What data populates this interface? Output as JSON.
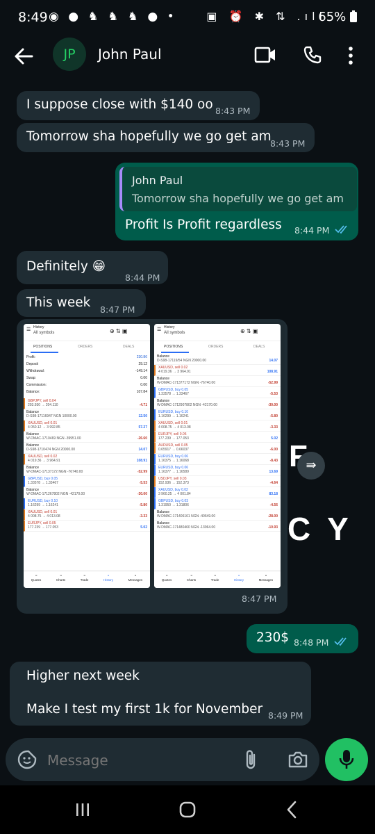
{
  "status_bar": {
    "time": "8:49",
    "left_icons": "◉ ● ♞ ♞ ♞ ● •",
    "right_icons": "▣ ⏰ ✱ ⇅ .ıll",
    "battery": "65%"
  },
  "header": {
    "avatar_initials": "JP",
    "contact_name": "John Paul"
  },
  "messages": [
    {
      "text": "I suppose close with $140 oo",
      "time": "8:43 PM"
    },
    {
      "text": "Tomorrow sha hopefully we go get am",
      "time": "8:43 PM"
    },
    {
      "quote_author": "John Paul",
      "quote_text": "Tomorrow sha hopefully we go get am",
      "text": "Profit Is Profit regardless",
      "time": "8:44 PM"
    },
    {
      "text": "Definitely 😁",
      "time": "8:44 PM"
    },
    {
      "text": "This week",
      "time": "8:47 PM"
    },
    {
      "time": "8:47 PM"
    },
    {
      "text": "230$",
      "time": "8:48 PM"
    },
    {
      "text": "Higher next week",
      "text2": "Make I test my first 1k for November",
      "time": "8:49 PM"
    }
  ],
  "overlay_letters": {
    "f": "F",
    "cy": "C Y"
  },
  "screenshot": {
    "title": "History",
    "subtitle": "All symbols",
    "tabs": [
      "POSITIONS",
      "ORDERS",
      "DEALS"
    ],
    "summary": [
      {
        "label": "Profit:",
        "value": "230.86"
      },
      {
        "label": "Deposit",
        "value": "29.12"
      },
      {
        "label": "Withdrawal:",
        "value": "-149.14"
      },
      {
        "label": "Swap:",
        "value": "0.00"
      },
      {
        "label": "Commission:",
        "value": "0.00"
      },
      {
        "label": "Balance:",
        "value": "107.84"
      }
    ],
    "left_rows": [
      {
        "sym": "GBPJPY, sell 0.04",
        "sub": "203.930 → 204.110",
        "val": "-4.71"
      },
      {
        "sym": "Balance",
        "sub": "D-S98-17116947 NGN 10000.00",
        "val": "12.50"
      },
      {
        "sym": "XAUUSD, sell 0.01",
        "sub": "4 050.12 → 3 992.85",
        "val": "57.27"
      },
      {
        "sym": "Balance",
        "sub": "W-DMAC-1710469 NGN -39951.00",
        "val": "-26.60"
      },
      {
        "sym": "Balance",
        "sub": "D-S98-1710474 NGN 20000.00",
        "val": "14.07"
      },
      {
        "sym": "XAUUSD, sell 0.02",
        "sub": "4 019.36 → 3 964.91",
        "val": "108.91"
      },
      {
        "sym": "Balance",
        "sub": "W-DMAC-17137172 NGN -76740.00",
        "val": "-52.99"
      },
      {
        "sym": "GBPUSD, buy 0.05",
        "sub": "1.33578 → 1.33467",
        "val": "-5.53"
      },
      {
        "sym": "Balance",
        "sub": "W-DMAC-171267802 NGN -42170.00",
        "val": "-30.00"
      },
      {
        "sym": "EURUSD, buy 0.10",
        "sub": "1.16299 → 1.16241",
        "val": "-5.80"
      },
      {
        "sym": "XAUUSD, sell 0.01",
        "sub": "4 008.75 → 4 013.08",
        "val": "-3.33"
      },
      {
        "sym": "EURJPY, sell 0.05",
        "sub": "177.239 → 177.053",
        "val": "5.02"
      }
    ],
    "right_rows": [
      {
        "sym": "Balance",
        "sub": "D-S98-17119/54 NGN 20000.00",
        "val": "14.07"
      },
      {
        "sym": "XAUUSD, sell 0.02",
        "sub": "4 019.36 → 3 964.91",
        "val": "108.91"
      },
      {
        "sym": "Balance",
        "sub": "W-DMAC-171377172 NGN -76740.00",
        "val": "-52.99"
      },
      {
        "sym": "GBPUSD, buy 0.05",
        "sub": "1.33578 → 1.33467",
        "val": "-5.53"
      },
      {
        "sym": "Balance",
        "sub": "W-DMAC-1712907802 NGN -42170.00",
        "val": "-30.00"
      },
      {
        "sym": "EURUSD, buy 0.10",
        "sub": "1.16299 → 1.16241",
        "val": "-5.80"
      },
      {
        "sym": "XAUUSD, sell 0.01",
        "sub": "4 008.75 → 4 013.08",
        "val": "-3.33"
      },
      {
        "sym": "EURJPY, sell 0.05",
        "sub": "177.239 → 177.053",
        "val": "5.02"
      },
      {
        "sym": "AUDUSD, sell 0.05",
        "sub": "0.65917 → 0.66037",
        "val": "-6.00"
      },
      {
        "sym": "EURUSD, buy 0.06",
        "sub": "1.16375 → 1.16068",
        "val": "-8.43"
      },
      {
        "sym": "EURUSD, buy 0.06",
        "sub": "1.16377 → 1.16589",
        "val": "13.69"
      },
      {
        "sym": "USDJPY, sell 0.03",
        "sub": "152.936 → 152.373",
        "val": "-4.64"
      },
      {
        "sym": "XAUUSD, buy 0.02",
        "sub": "3 960.25 → 4 001.84",
        "val": "83.18"
      },
      {
        "sym": "GBPUSD, buy 0.03",
        "sub": "1.31950 → 1.31806",
        "val": "-4.56"
      },
      {
        "sym": "Balance",
        "sub": "W-DMAC-171406161 NGN -40649.00",
        "val": "-28.00"
      },
      {
        "sym": "Balance",
        "sub": "W-DMAC-171480460 NGN -13964.00",
        "val": "-10.93"
      }
    ],
    "bottom_nav": [
      "Quotes",
      "Charts",
      "Trade",
      "History",
      "Messages"
    ]
  },
  "composer": {
    "placeholder": "Message"
  },
  "colors": {
    "outgoing": "#005c4b",
    "incoming": "#1f2c33",
    "accent": "#25d366",
    "background": "#0b1014"
  }
}
